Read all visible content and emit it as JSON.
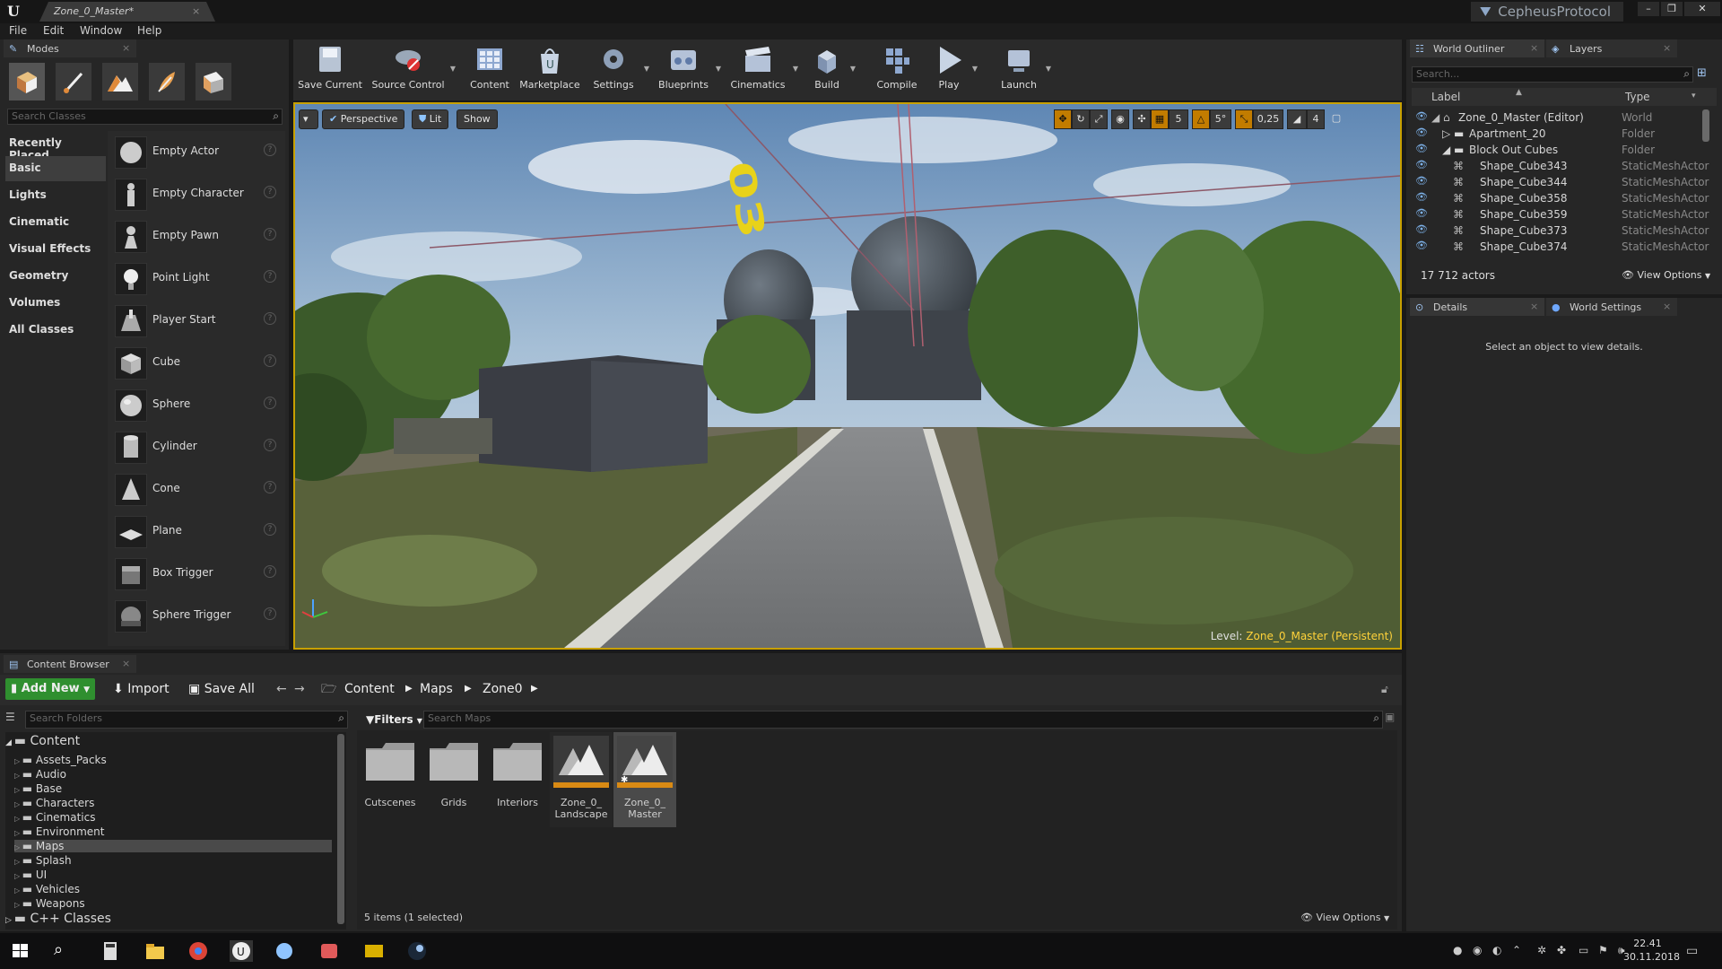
{
  "window": {
    "tab_title": "Zone_0_Master*",
    "project_name": "CepheusProtocol"
  },
  "menu": [
    "File",
    "Edit",
    "Window",
    "Help"
  ],
  "modes": {
    "tab_label": "Modes",
    "search_placeholder": "Search Classes",
    "categories": [
      "Recently Placed",
      "Basic",
      "Lights",
      "Cinematic",
      "Visual Effects",
      "Geometry",
      "Volumes",
      "All Classes"
    ],
    "selected_category": "Basic",
    "items": [
      "Empty Actor",
      "Empty Character",
      "Empty Pawn",
      "Point Light",
      "Player Start",
      "Cube",
      "Sphere",
      "Cylinder",
      "Cone",
      "Plane",
      "Box Trigger",
      "Sphere Trigger"
    ]
  },
  "toolbar": {
    "buttons": [
      "Save Current",
      "Source Control",
      "Content",
      "Marketplace",
      "Settings",
      "Blueprints",
      "Cinematics",
      "Build",
      "Compile",
      "Play",
      "Launch"
    ]
  },
  "viewport": {
    "perspective_label": "Perspective",
    "lit_label": "Lit",
    "show_label": "Show",
    "grid_snap": "5",
    "rot_snap": "5°",
    "scale_snap": "0,25",
    "camera_speed": "4",
    "level_prefix": "Level:",
    "level_name": "Zone_0_Master (Persistent)",
    "sign_text": "03"
  },
  "content_browser": {
    "tab_label": "Content Browser",
    "add_new": "Add New",
    "import": "Import",
    "save_all": "Save All",
    "breadcrumb": [
      "Content",
      "Maps",
      "Zone0"
    ],
    "search_folders_placeholder": "Search Folders",
    "filters_label": "Filters",
    "search_maps_placeholder": "Search Maps",
    "tree_root": "Content",
    "folders": [
      "Assets_Packs",
      "Audio",
      "Base",
      "Characters",
      "Cinematics",
      "Environment",
      "Maps",
      "Splash",
      "UI",
      "Vehicles",
      "Weapons"
    ],
    "selected_folder": "Maps",
    "cpp_classes": "C++ Classes",
    "assets": [
      {
        "name": "Cutscenes",
        "kind": "folder"
      },
      {
        "name": "Grids",
        "kind": "folder"
      },
      {
        "name": "Interiors",
        "kind": "folder"
      },
      {
        "name": "Zone_0_\nLandscape",
        "kind": "map"
      },
      {
        "name": "Zone_0_\nMaster",
        "kind": "map"
      }
    ],
    "status": "5 items (1 selected)",
    "view_options": "View Options"
  },
  "outliner": {
    "tab_label": "World Outliner",
    "layers_tab": "Layers",
    "search_placeholder": "Search...",
    "col_label": "Label",
    "col_type": "Type",
    "rows": [
      {
        "label": "Zone_0_Master (Editor)",
        "type": "World",
        "indent": 0
      },
      {
        "label": "Apartment_20",
        "type": "Folder",
        "indent": 1
      },
      {
        "label": "Block Out Cubes",
        "type": "Folder",
        "indent": 1
      },
      {
        "label": "Shape_Cube343",
        "type": "StaticMeshActor",
        "indent": 2
      },
      {
        "label": "Shape_Cube344",
        "type": "StaticMeshActor",
        "indent": 2
      },
      {
        "label": "Shape_Cube358",
        "type": "StaticMeshActor",
        "indent": 2
      },
      {
        "label": "Shape_Cube359",
        "type": "StaticMeshActor",
        "indent": 2
      },
      {
        "label": "Shape_Cube373",
        "type": "StaticMeshActor",
        "indent": 2
      },
      {
        "label": "Shape_Cube374",
        "type": "StaticMeshActor",
        "indent": 2
      }
    ],
    "actor_count": "17 712 actors",
    "view_options": "View Options"
  },
  "details": {
    "tab_label": "Details",
    "world_settings_tab": "World Settings",
    "empty_message": "Select an object to view details."
  },
  "taskbar": {
    "time": "22.41",
    "date": "30.11.2018"
  },
  "colors": {
    "accent": "#c8a000",
    "add_new_green": "#2f8f2f",
    "selection_orange": "#c27c00"
  }
}
